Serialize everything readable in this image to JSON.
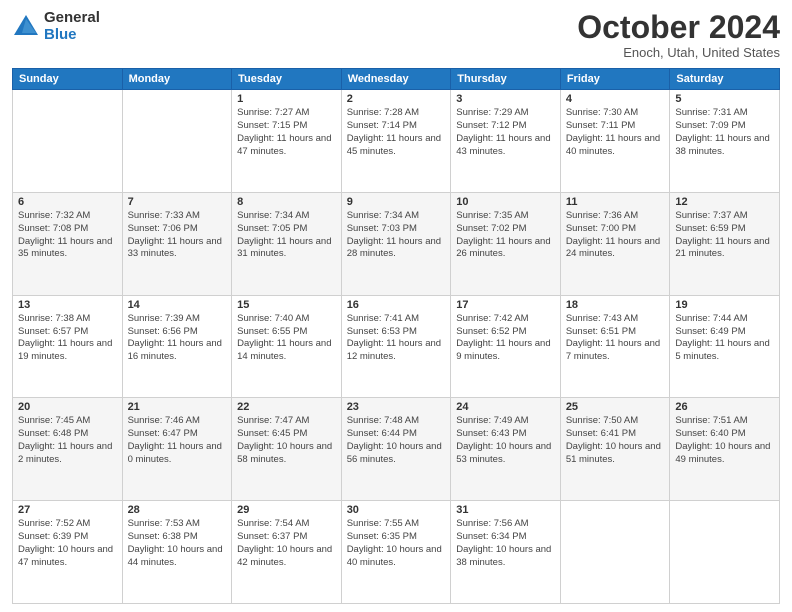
{
  "header": {
    "logo_general": "General",
    "logo_blue": "Blue",
    "month_title": "October 2024",
    "location": "Enoch, Utah, United States"
  },
  "days_of_week": [
    "Sunday",
    "Monday",
    "Tuesday",
    "Wednesday",
    "Thursday",
    "Friday",
    "Saturday"
  ],
  "weeks": [
    [
      {
        "day": "",
        "info": ""
      },
      {
        "day": "",
        "info": ""
      },
      {
        "day": "1",
        "info": "Sunrise: 7:27 AM\nSunset: 7:15 PM\nDaylight: 11 hours and 47 minutes."
      },
      {
        "day": "2",
        "info": "Sunrise: 7:28 AM\nSunset: 7:14 PM\nDaylight: 11 hours and 45 minutes."
      },
      {
        "day": "3",
        "info": "Sunrise: 7:29 AM\nSunset: 7:12 PM\nDaylight: 11 hours and 43 minutes."
      },
      {
        "day": "4",
        "info": "Sunrise: 7:30 AM\nSunset: 7:11 PM\nDaylight: 11 hours and 40 minutes."
      },
      {
        "day": "5",
        "info": "Sunrise: 7:31 AM\nSunset: 7:09 PM\nDaylight: 11 hours and 38 minutes."
      }
    ],
    [
      {
        "day": "6",
        "info": "Sunrise: 7:32 AM\nSunset: 7:08 PM\nDaylight: 11 hours and 35 minutes."
      },
      {
        "day": "7",
        "info": "Sunrise: 7:33 AM\nSunset: 7:06 PM\nDaylight: 11 hours and 33 minutes."
      },
      {
        "day": "8",
        "info": "Sunrise: 7:34 AM\nSunset: 7:05 PM\nDaylight: 11 hours and 31 minutes."
      },
      {
        "day": "9",
        "info": "Sunrise: 7:34 AM\nSunset: 7:03 PM\nDaylight: 11 hours and 28 minutes."
      },
      {
        "day": "10",
        "info": "Sunrise: 7:35 AM\nSunset: 7:02 PM\nDaylight: 11 hours and 26 minutes."
      },
      {
        "day": "11",
        "info": "Sunrise: 7:36 AM\nSunset: 7:00 PM\nDaylight: 11 hours and 24 minutes."
      },
      {
        "day": "12",
        "info": "Sunrise: 7:37 AM\nSunset: 6:59 PM\nDaylight: 11 hours and 21 minutes."
      }
    ],
    [
      {
        "day": "13",
        "info": "Sunrise: 7:38 AM\nSunset: 6:57 PM\nDaylight: 11 hours and 19 minutes."
      },
      {
        "day": "14",
        "info": "Sunrise: 7:39 AM\nSunset: 6:56 PM\nDaylight: 11 hours and 16 minutes."
      },
      {
        "day": "15",
        "info": "Sunrise: 7:40 AM\nSunset: 6:55 PM\nDaylight: 11 hours and 14 minutes."
      },
      {
        "day": "16",
        "info": "Sunrise: 7:41 AM\nSunset: 6:53 PM\nDaylight: 11 hours and 12 minutes."
      },
      {
        "day": "17",
        "info": "Sunrise: 7:42 AM\nSunset: 6:52 PM\nDaylight: 11 hours and 9 minutes."
      },
      {
        "day": "18",
        "info": "Sunrise: 7:43 AM\nSunset: 6:51 PM\nDaylight: 11 hours and 7 minutes."
      },
      {
        "day": "19",
        "info": "Sunrise: 7:44 AM\nSunset: 6:49 PM\nDaylight: 11 hours and 5 minutes."
      }
    ],
    [
      {
        "day": "20",
        "info": "Sunrise: 7:45 AM\nSunset: 6:48 PM\nDaylight: 11 hours and 2 minutes."
      },
      {
        "day": "21",
        "info": "Sunrise: 7:46 AM\nSunset: 6:47 PM\nDaylight: 11 hours and 0 minutes."
      },
      {
        "day": "22",
        "info": "Sunrise: 7:47 AM\nSunset: 6:45 PM\nDaylight: 10 hours and 58 minutes."
      },
      {
        "day": "23",
        "info": "Sunrise: 7:48 AM\nSunset: 6:44 PM\nDaylight: 10 hours and 56 minutes."
      },
      {
        "day": "24",
        "info": "Sunrise: 7:49 AM\nSunset: 6:43 PM\nDaylight: 10 hours and 53 minutes."
      },
      {
        "day": "25",
        "info": "Sunrise: 7:50 AM\nSunset: 6:41 PM\nDaylight: 10 hours and 51 minutes."
      },
      {
        "day": "26",
        "info": "Sunrise: 7:51 AM\nSunset: 6:40 PM\nDaylight: 10 hours and 49 minutes."
      }
    ],
    [
      {
        "day": "27",
        "info": "Sunrise: 7:52 AM\nSunset: 6:39 PM\nDaylight: 10 hours and 47 minutes."
      },
      {
        "day": "28",
        "info": "Sunrise: 7:53 AM\nSunset: 6:38 PM\nDaylight: 10 hours and 44 minutes."
      },
      {
        "day": "29",
        "info": "Sunrise: 7:54 AM\nSunset: 6:37 PM\nDaylight: 10 hours and 42 minutes."
      },
      {
        "day": "30",
        "info": "Sunrise: 7:55 AM\nSunset: 6:35 PM\nDaylight: 10 hours and 40 minutes."
      },
      {
        "day": "31",
        "info": "Sunrise: 7:56 AM\nSunset: 6:34 PM\nDaylight: 10 hours and 38 minutes."
      },
      {
        "day": "",
        "info": ""
      },
      {
        "day": "",
        "info": ""
      }
    ]
  ]
}
